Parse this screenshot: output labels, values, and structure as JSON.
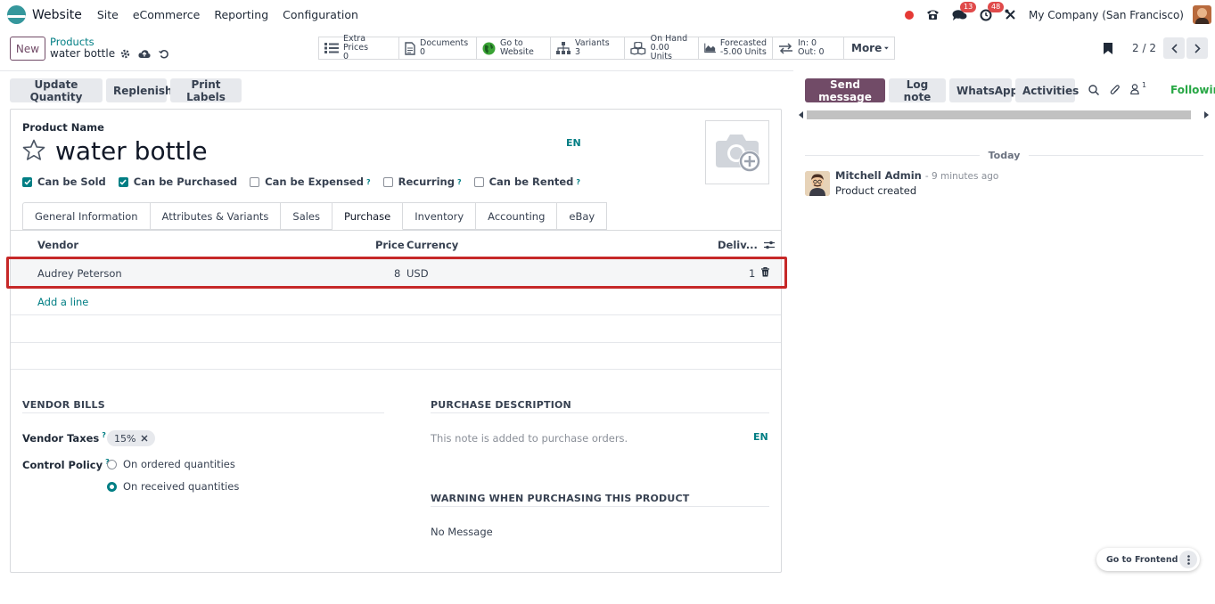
{
  "topnav": {
    "app_name": "Website",
    "menu": [
      "Site",
      "eCommerce",
      "Reporting",
      "Configuration"
    ],
    "badges": {
      "messages": "13",
      "activities": "48"
    },
    "company": "My Company (San Francisco)"
  },
  "control": {
    "new_label": "New",
    "breadcrumb_parent": "Products",
    "breadcrumb_current": "water bottle",
    "smart_buttons": [
      {
        "label": "Extra Prices",
        "value": "0",
        "icon": "list-icon"
      },
      {
        "label": "Documents",
        "value": "0",
        "icon": "document-icon"
      },
      {
        "label": "Go to",
        "value": "Website",
        "icon": "globe-icon"
      },
      {
        "label": "Variants",
        "value": "3",
        "icon": "sitemap-icon"
      },
      {
        "label": "On Hand",
        "value": "0.00 Units",
        "icon": "cubes-icon"
      },
      {
        "label": "Forecasted",
        "value": "-5.00 Units",
        "icon": "area-chart-icon"
      },
      {
        "label": "In: 0",
        "value": "Out: 0",
        "icon": "exchange-icon"
      }
    ],
    "more_label": "More",
    "pager": "2 / 2"
  },
  "actions": [
    "Update Quantity",
    "Replenish",
    "Print Labels"
  ],
  "form": {
    "product_name_label": "Product Name",
    "product_name": "water bottle",
    "lang": "EN",
    "checkboxes": [
      {
        "label": "Can be Sold",
        "checked": true,
        "help": false
      },
      {
        "label": "Can be Purchased",
        "checked": true,
        "help": false
      },
      {
        "label": "Can be Expensed",
        "checked": false,
        "help": true
      },
      {
        "label": "Recurring",
        "checked": false,
        "help": true
      },
      {
        "label": "Can be Rented",
        "checked": false,
        "help": true
      }
    ],
    "tabs": [
      "General Information",
      "Attributes & Variants",
      "Sales",
      "Purchase",
      "Inventory",
      "Accounting",
      "eBay"
    ],
    "active_tab": "Purchase",
    "table": {
      "headers": {
        "vendor": "Vendor",
        "price": "Price",
        "currency": "Currency",
        "delivery": "Deliv..."
      },
      "rows": [
        {
          "vendor": "Audrey Peterson",
          "price": "8",
          "currency": "USD",
          "delivery": "1"
        }
      ],
      "add_line": "Add a line"
    },
    "vendor_bills": {
      "title": "VENDOR BILLS",
      "taxes_label": "Vendor Taxes",
      "tax_tag": "15%",
      "control_label": "Control Policy",
      "options": [
        {
          "label": "On ordered quantities",
          "selected": false
        },
        {
          "label": "On received quantities",
          "selected": true
        }
      ]
    },
    "purchase_description": {
      "title": "PURCHASE DESCRIPTION",
      "placeholder": "This note is added to purchase orders.",
      "lang": "EN"
    },
    "warning": {
      "title": "WARNING WHEN PURCHASING THIS PRODUCT",
      "value": "No Message"
    }
  },
  "chatter": {
    "send_message": "Send message",
    "log_note": "Log note",
    "whatsapp": "WhatsApp",
    "activities": "Activities",
    "followers_count": "1",
    "following": "Following",
    "today": "Today",
    "message": {
      "author": "Mitchell Admin",
      "time": "- 9 minutes ago",
      "body": "Product created"
    }
  },
  "go_frontend": "Go to Frontend",
  "colors": {
    "primary": "#714b67",
    "teal": "#017e84",
    "highlight": "#c62828",
    "following": "#28a745"
  }
}
